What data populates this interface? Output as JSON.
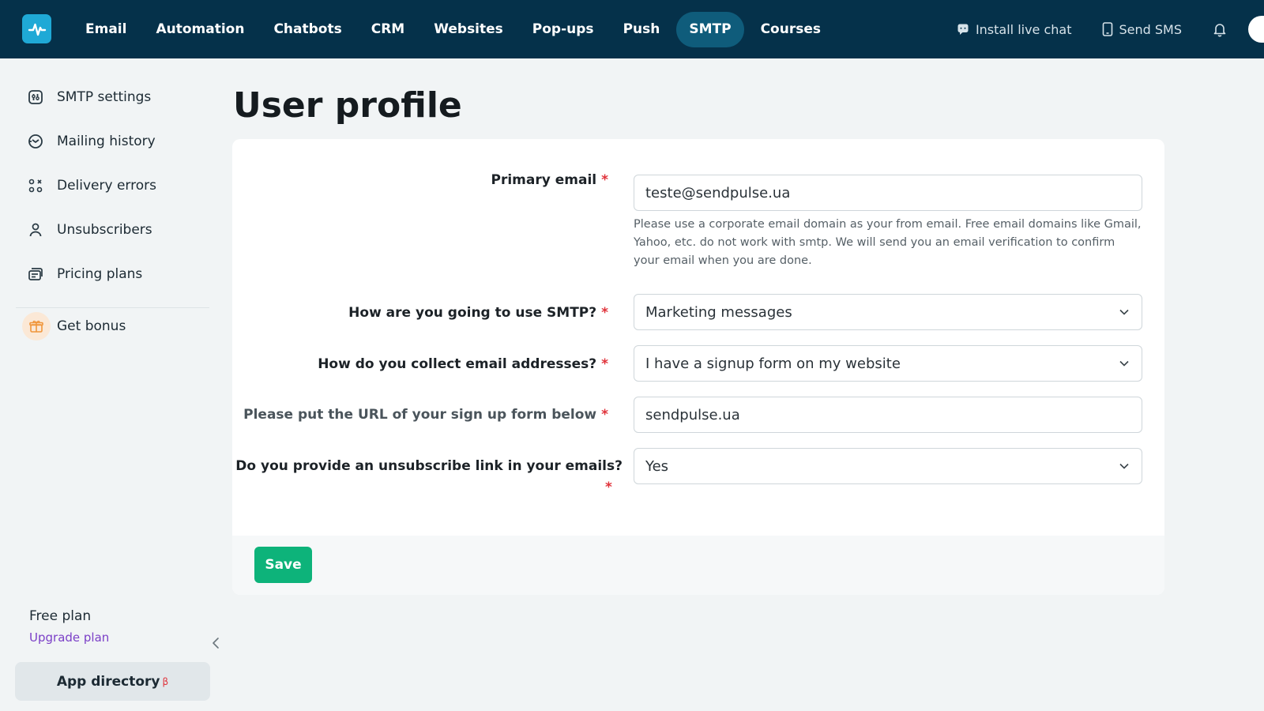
{
  "topnav": {
    "items": [
      {
        "label": "Email",
        "active": false
      },
      {
        "label": "Automation",
        "active": false
      },
      {
        "label": "Chatbots",
        "active": false
      },
      {
        "label": "CRM",
        "active": false
      },
      {
        "label": "Websites",
        "active": false
      },
      {
        "label": "Pop-ups",
        "active": false
      },
      {
        "label": "Push",
        "active": false
      },
      {
        "label": "SMTP",
        "active": true
      },
      {
        "label": "Courses",
        "active": false
      }
    ],
    "install_chat": "Install live chat",
    "send_sms": "Send SMS"
  },
  "sidebar": {
    "items": [
      {
        "label": "SMTP settings",
        "icon": "smtp-settings-icon"
      },
      {
        "label": "Mailing history",
        "icon": "mailing-history-icon"
      },
      {
        "label": "Delivery errors",
        "icon": "delivery-errors-icon"
      },
      {
        "label": "Unsubscribers",
        "icon": "unsubscribers-icon"
      },
      {
        "label": "Pricing plans",
        "icon": "pricing-plans-icon"
      }
    ],
    "bonus": "Get bonus",
    "plan": "Free plan",
    "upgrade": "Upgrade plan",
    "app_directory": "App directory",
    "beta": "β"
  },
  "page": {
    "title": "User profile"
  },
  "form": {
    "primary_email": {
      "label": "Primary email",
      "value": "teste@sendpulse.ua",
      "hint": "Please use a corporate email domain as your from email. Free email domains like Gmail, Yahoo, etc. do not work with smtp. We will send you an email verification to confirm your email when you are done."
    },
    "usage": {
      "label": "How are you going to use SMTP?",
      "value": "Marketing messages"
    },
    "collect": {
      "label": "How do you collect email addresses?",
      "value": "I have a signup form on my website"
    },
    "url": {
      "label": "Please put the URL of your sign up form below",
      "value": "sendpulse.ua"
    },
    "unsubscribe": {
      "label": "Do you provide an unsubscribe link in your emails?",
      "value": "Yes"
    },
    "required_mark": "*",
    "save_label": "Save"
  },
  "colors": {
    "topbar": "#05314a",
    "active_tab": "#0f5c7b",
    "save": "#0db37a",
    "required": "#e0323a",
    "upgrade_link": "#7b3fc7"
  }
}
